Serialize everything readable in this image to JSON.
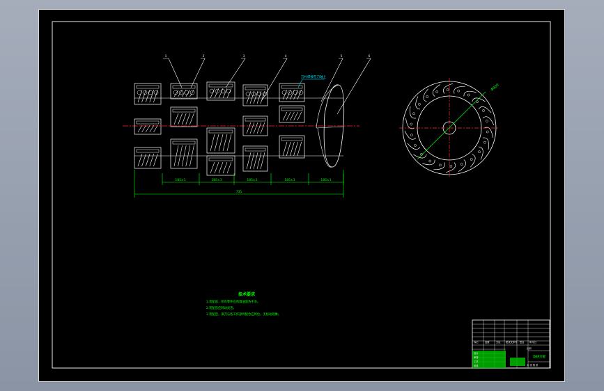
{
  "notes": {
    "title": "技术要求",
    "lines": [
      "1.装配前，所有零件应用煤油清洗干净。",
      "2.装配后应转动灵活。",
      "3.装配后，滚刀与各工作部件配合应到位，无松动现象。"
    ]
  },
  "dimensions": {
    "overall": "735",
    "segments": [
      "185±1",
      "185±1",
      "185±1",
      "185±1",
      "185±1"
    ],
    "diameter": "Φ800",
    "callout_text": "刀片焊接在刀轴上"
  },
  "balloons": [
    "1",
    "2",
    "3",
    "4",
    "5",
    "6"
  ],
  "title_block": {
    "drawing_title": "旋耕刀辊",
    "row_labels": [
      "标记",
      "处数",
      "分区",
      "更改文件号",
      "签名",
      "年月日"
    ],
    "roles": [
      "设计",
      "审核",
      "工艺",
      "批准"
    ],
    "scale_label": "比例",
    "sheet_label": "共 张 第 张"
  },
  "colors": {
    "background": "#000000",
    "outline": "#ffffff",
    "annotation": "#00ff00",
    "centerline": "#ff0000",
    "callout": "#00ffff"
  }
}
